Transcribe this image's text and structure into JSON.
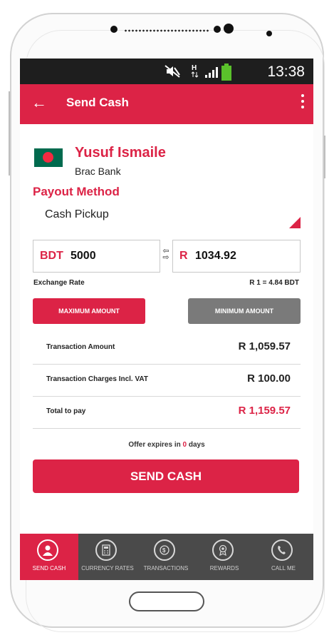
{
  "status_bar": {
    "time": "13:38"
  },
  "app_bar": {
    "title": "Send Cash"
  },
  "recipient": {
    "name": "Yusuf Ismaile",
    "bank": "Brac Bank"
  },
  "payout": {
    "label": "Payout Method",
    "value": "Cash Pickup"
  },
  "send_amount": {
    "currency": "BDT",
    "value": "5000"
  },
  "receive_amount": {
    "currency": "R",
    "value": "1034.92"
  },
  "exchange": {
    "label": "Exchange Rate",
    "value": "R 1 = 4.84 BDT"
  },
  "buttons": {
    "max": "MAXIMUM AMOUNT",
    "min": "MINIMUM AMOUNT",
    "send": "SEND CASH"
  },
  "summary": [
    {
      "label": "Transaction Amount",
      "amount": "R 1,059.57"
    },
    {
      "label": "Transaction Charges Incl. VAT",
      "amount": "R 100.00"
    },
    {
      "label": "Total to pay",
      "amount": "R 1,159.57"
    }
  ],
  "offer": {
    "prefix": "Offer expires in ",
    "days": "0",
    "suffix": " days"
  },
  "bottom_nav": [
    {
      "label": "SEND CASH",
      "icon": "send-cash-icon"
    },
    {
      "label": "CURRENCY RATES",
      "icon": "calculator-icon"
    },
    {
      "label": "TRANSACTIONS",
      "icon": "transactions-icon"
    },
    {
      "label": "REWARDS",
      "icon": "rewards-icon"
    },
    {
      "label": "CALL ME",
      "icon": "phone-icon"
    }
  ],
  "colors": {
    "accent": "#dc2346",
    "dark": "#1e1e1e",
    "nav": "#4a4a4a",
    "disabled": "#7a7a7a"
  }
}
